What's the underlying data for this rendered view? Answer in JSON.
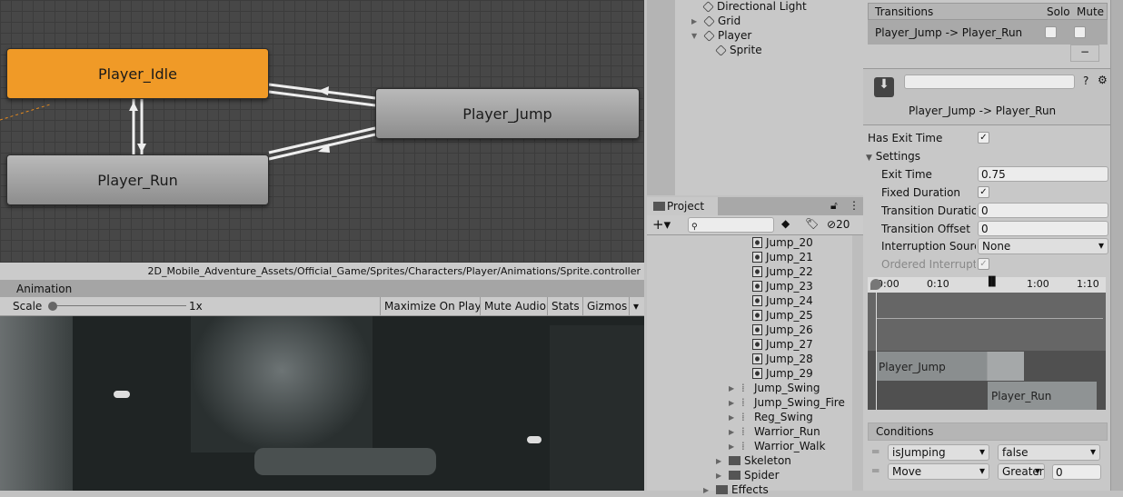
{
  "animator": {
    "states": [
      {
        "name": "Player_Idle",
        "color": "#f09a27"
      },
      {
        "name": "Player_Jump"
      },
      {
        "name": "Player_Run"
      }
    ],
    "path": "2D_Mobile_Adventure_Assets/Official_Game/Sprites/Characters/Player/Animations/Sprite.controller"
  },
  "game": {
    "tab": "Animation",
    "scale_label": "Scale",
    "scale_value": "1x",
    "buttons": [
      "Maximize On Play",
      "Mute Audio",
      "Stats",
      "Gizmos"
    ]
  },
  "hierarchy": {
    "items": [
      "Directional Light",
      "Grid",
      "Player",
      "Sprite"
    ]
  },
  "project": {
    "tab": "Project",
    "hidden_count": "20",
    "sprites": [
      "Jump_20",
      "Jump_21",
      "Jump_22",
      "Jump_23",
      "Jump_24",
      "Jump_25",
      "Jump_26",
      "Jump_27",
      "Jump_28",
      "Jump_29"
    ],
    "subitems": [
      "Jump_Swing",
      "Jump_Swing_Fire",
      "Reg_Swing",
      "Warrior_Run",
      "Warrior_Walk"
    ],
    "folders": [
      "Skeleton",
      "Spider",
      "Effects"
    ]
  },
  "inspector": {
    "transitions_header": "Transitions",
    "solo": "Solo",
    "mute": "Mute",
    "transition": "Player_Jump -> Player_Run",
    "minus": "−",
    "title": "Player_Jump -> Player_Run",
    "has_exit_time": "Has Exit Time",
    "settings": "Settings",
    "exit_time_label": "Exit Time",
    "exit_time": "0.75",
    "fixed_duration": "Fixed Duration",
    "transition_duration_label": "Transition Duration",
    "transition_duration": "0",
    "transition_offset_label": "Transition Offset",
    "transition_offset": "0",
    "interruption_source_label": "Interruption Source",
    "interruption_source": "None",
    "ordered_interruption": "Ordered Interruption",
    "timeline_ticks": [
      "0:00",
      "0:10",
      "1:00",
      "1:10"
    ],
    "timeline_clips": [
      "Player_Jump",
      "Player_Run"
    ],
    "conditions_header": "Conditions",
    "conditions": [
      {
        "param": "isJumping",
        "op": "false",
        "value": ""
      },
      {
        "param": "Move",
        "op": "Greater",
        "value": "0"
      }
    ]
  }
}
